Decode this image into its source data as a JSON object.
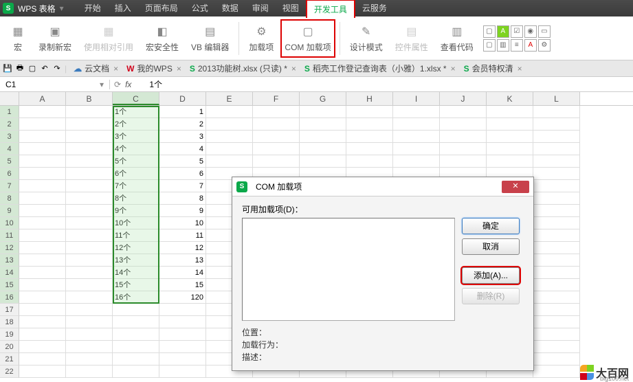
{
  "app": {
    "name": "WPS 表格"
  },
  "menu_tabs": [
    "开始",
    "插入",
    "页面布局",
    "公式",
    "数据",
    "审阅",
    "视图",
    "开发工具",
    "云服务"
  ],
  "menu_active_index": 7,
  "ribbon": [
    {
      "label": "宏",
      "icon": "▦",
      "disabled": false
    },
    {
      "label": "录制新宏",
      "icon": "▣",
      "disabled": false
    },
    {
      "label": "使用相对引用",
      "icon": "▦",
      "disabled": true
    },
    {
      "label": "宏安全性",
      "icon": "◧",
      "disabled": false
    },
    {
      "label": "VB 编辑器",
      "icon": "▤",
      "disabled": false
    },
    {
      "label": "加载项",
      "icon": "⚙",
      "disabled": false
    },
    {
      "label": "COM 加载项",
      "icon": "▢",
      "disabled": false,
      "highlight": true
    },
    {
      "label": "设计模式",
      "icon": "✎",
      "disabled": false
    },
    {
      "label": "控件属性",
      "icon": "▤",
      "disabled": true
    },
    {
      "label": "查看代码",
      "icon": "▥",
      "disabled": false
    }
  ],
  "doc_tabs": [
    {
      "label": "云文档",
      "icon": "☁"
    },
    {
      "label": "我的WPS",
      "icon": "W"
    },
    {
      "label": "2013功能树.xlsx (只读) *",
      "icon": "S"
    },
    {
      "label": "稻壳工作登记查询表（小雅）1.xlsx *",
      "icon": "S"
    },
    {
      "label": "会员特权清",
      "icon": "S"
    }
  ],
  "name_box": "C1",
  "fx_value": "1个",
  "columns": [
    "A",
    "B",
    "C",
    "D",
    "E",
    "F",
    "G",
    "H",
    "I",
    "J",
    "K",
    "L"
  ],
  "rows": [
    {
      "n": 1,
      "C": "1个",
      "D": "1"
    },
    {
      "n": 2,
      "C": "2个",
      "D": "2"
    },
    {
      "n": 3,
      "C": "3个",
      "D": "3"
    },
    {
      "n": 4,
      "C": "4个",
      "D": "4"
    },
    {
      "n": 5,
      "C": "5个",
      "D": "5"
    },
    {
      "n": 6,
      "C": "6个",
      "D": "6"
    },
    {
      "n": 7,
      "C": "7个",
      "D": "7"
    },
    {
      "n": 8,
      "C": "8个",
      "D": "8"
    },
    {
      "n": 9,
      "C": "9个",
      "D": "9"
    },
    {
      "n": 10,
      "C": "10个",
      "D": "10"
    },
    {
      "n": 11,
      "C": "11个",
      "D": "11"
    },
    {
      "n": 12,
      "C": "12个",
      "D": "12"
    },
    {
      "n": 13,
      "C": "13个",
      "D": "13"
    },
    {
      "n": 14,
      "C": "14个",
      "D": "14"
    },
    {
      "n": 15,
      "C": "15个",
      "D": "15"
    },
    {
      "n": 16,
      "C": "16个",
      "D": "120"
    },
    {
      "n": 17
    },
    {
      "n": 18
    },
    {
      "n": 19
    },
    {
      "n": 20
    },
    {
      "n": 21
    },
    {
      "n": 22
    }
  ],
  "selection": {
    "col": "C",
    "rows": [
      1,
      16
    ]
  },
  "dialog": {
    "title": "COM 加载项",
    "label": "可用加载项(D)：",
    "ok": "确定",
    "cancel": "取消",
    "add": "添加(A)...",
    "remove": "删除(R)",
    "loc_label": "位置：",
    "behavior_label": "加载行为：",
    "desc_label": "描述："
  },
  "watermark": {
    "text": "大百网",
    "url": "big100.net"
  }
}
